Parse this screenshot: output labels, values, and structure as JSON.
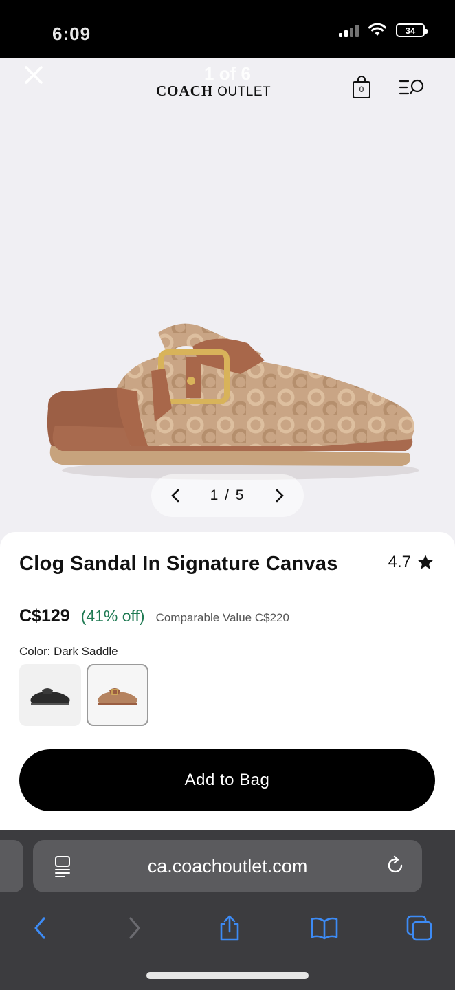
{
  "status_bar": {
    "time": "6:09",
    "battery": "34"
  },
  "gallery": {
    "counter": "1 of 6",
    "brand_name": "COACH",
    "brand_suffix": "OUTLET",
    "bag_count": "0",
    "pager_text": "1 / 5"
  },
  "product": {
    "title": "Clog Sandal In Signature Canvas",
    "rating": "4.7",
    "price": "C$129",
    "discount": "(41% off)",
    "comparable": "Comparable Value C$220",
    "color_label": "Color: Dark Saddle",
    "swatches": [
      {
        "color": "#2b2b2b"
      },
      {
        "color": "#b07a55",
        "selected": true
      }
    ],
    "add_to_bag": "Add to Bag"
  },
  "browser": {
    "url": "ca.coachoutlet.com",
    "accent_color": "#3d8bf5"
  }
}
